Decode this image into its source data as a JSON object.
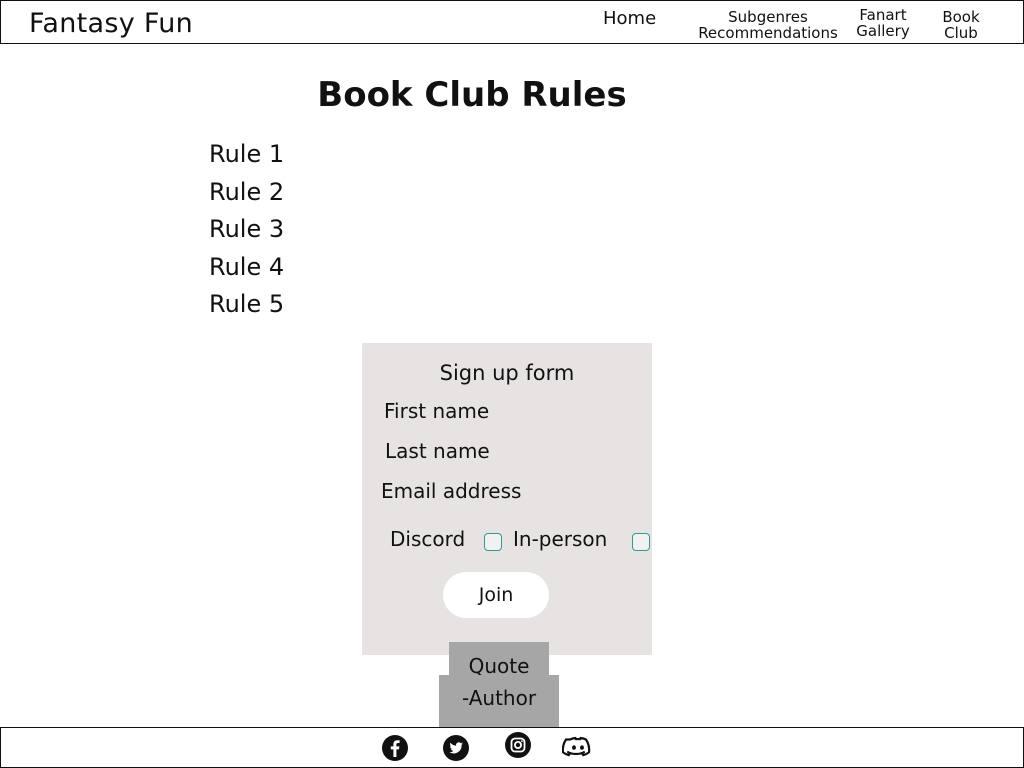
{
  "header": {
    "site_title": "Fantasy Fun",
    "nav": {
      "home": "Home",
      "subgenres": "Subgenres Recommendations",
      "fanart": "Fanart Gallery",
      "book_club": "Book Club"
    }
  },
  "main": {
    "title": "Book Club Rules",
    "rules": [
      "Rule 1",
      "Rule 2",
      "Rule 3",
      "Rule 4",
      "Rule 5"
    ]
  },
  "signup_form": {
    "title": "Sign up form",
    "first_name_placeholder": "First name",
    "last_name_placeholder": "Last name",
    "email_placeholder": "Email address",
    "option_discord": "Discord",
    "option_in_person": "In-person",
    "join_label": "Join"
  },
  "quote": {
    "text": "Quote",
    "author": "-Author"
  },
  "footer": {
    "icons": [
      "facebook-icon",
      "twitter-icon",
      "instagram-icon",
      "discord-icon"
    ]
  }
}
